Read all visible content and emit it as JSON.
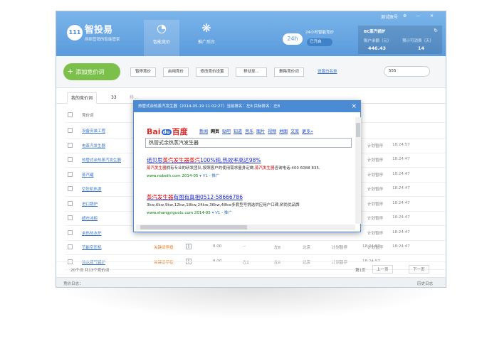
{
  "app": {
    "name": "智投易",
    "subtitle": "网络营销的智能管家"
  },
  "nav": [
    {
      "label": "智能竞价",
      "icon": "gauge-icon"
    },
    {
      "label": "推广后台",
      "icon": "paw-icon"
    }
  ],
  "window_controls": {
    "account": "测试账号",
    "gear": "⚙",
    "minimize": "—",
    "close": "✕"
  },
  "auto_bid": {
    "label": "24小时智能竞价",
    "state": "已开启",
    "badge": "24h"
  },
  "account": {
    "title": "BC蒸汽锅炉",
    "balance_label": "账户余额（元）",
    "balance": "446.43",
    "days_label": "预计可消费（天）",
    "days": "14"
  },
  "toolbar": {
    "add_label": "添加竞价词",
    "buttons": [
      "暂停竞价",
      "启用竞价",
      "修改竞价设置",
      "移动至...",
      "删除竞价词"
    ],
    "whitelist": "设置白名单",
    "search_value": "555"
  },
  "tabs": [
    {
      "label": "我的竞价词"
    },
    {
      "label": "33"
    },
    {
      "label": "移..."
    }
  ],
  "grid": {
    "header": "竞价词",
    "rows": [
      {
        "kw": "设备安装工程",
        "status": "",
        "c3": "",
        "c4": "",
        "c5": "",
        "c6": "",
        "c7": "",
        "c8": "",
        "c9": ""
      },
      {
        "kw": "电蒸汽发生器",
        "status": "",
        "c3": "",
        "c4": "",
        "c5": "",
        "c6": "",
        "c7": "",
        "c8": "",
        "c9": ""
      },
      {
        "kw": "热管式余热蒸汽发生器",
        "status": "",
        "c3": "",
        "c4": "",
        "c5": "",
        "c6": "",
        "c7": "",
        "c8": "",
        "c9": ""
      },
      {
        "kw": "蒸汽罐",
        "status": "",
        "c3": "",
        "c4": "",
        "c5": "",
        "c6": "",
        "c7": "",
        "c8": "",
        "c9": ""
      },
      {
        "kw": "空压机热源",
        "status": "",
        "c3": "",
        "c4": "",
        "c5": "",
        "c6": "",
        "c7": "",
        "c8": "",
        "c9": ""
      },
      {
        "kw": "进口锅炉",
        "status": "",
        "c3": "",
        "c4": "",
        "c5": "",
        "c6": "",
        "c7": "",
        "c8": "",
        "c9": ""
      },
      {
        "kw": "超市冰柜",
        "status": "",
        "c3": "",
        "c4": "",
        "c5": "",
        "c6": "",
        "c7": "",
        "c8": "",
        "c9": ""
      },
      {
        "kw": "余热热水炉",
        "status": "",
        "c3": "",
        "c4": "",
        "c5": "",
        "c6": "",
        "c7": "",
        "c8": "",
        "c9": ""
      },
      {
        "kw": "节能空压机",
        "status": "关键词停投",
        "c3": "8.00",
        "c4": "--",
        "c5": "左8",
        "c6": "北京",
        "c7": "计划暂停",
        "c8": "18:24:57",
        "c9": ""
      },
      {
        "kw": "热水燃气锅炉",
        "status": "关键词停投",
        "c3": "8.00",
        "c4": "左2",
        "c5": "左8",
        "c6": "北京",
        "c7": "计划暂停",
        "c8": "18:24:57",
        "c9": ""
      }
    ],
    "right_rows": [
      {
        "a": "计划暂停",
        "b": "18:24:57"
      },
      {
        "a": "计划暂停",
        "b": "18:24:47"
      },
      {
        "a": "计划暂停",
        "b": "18:24:47"
      },
      {
        "a": "计划暂停",
        "b": "18:24:47"
      },
      {
        "a": "计划暂停",
        "b": "18:24:47"
      },
      {
        "a": "计划暂停",
        "b": "18:24:47"
      },
      {
        "a": "计划暂停",
        "b": "18:24:47"
      },
      {
        "a": "计划暂停",
        "b": "18:24:47"
      }
    ]
  },
  "footer": {
    "count": "20个词 共13个竞价词",
    "first": "第1页",
    "prev": "上一页",
    "next": "下一页"
  },
  "status_bar": {
    "left": "竞价日志：",
    "right": "历史日志"
  },
  "popup": {
    "title": "热管式余热蒸汽发生器（2014-05-19 11:02:27）当前排名：左8 目标排名：左8",
    "baidu_nav": [
      "新闻",
      "网页",
      "贴吧",
      "知道",
      "音乐",
      "图片",
      "视频",
      "地图",
      "文库",
      "更多»"
    ],
    "baidu_nav_active": "网页",
    "query": "热管式余热蒸汽发生器",
    "results": [
      {
        "title_pre": "诺贝思",
        "title_hl": "蒸汽发生器蒸汽",
        "title_post": "100%纯,热效率高达98%",
        "desc_hl1": "蒸汽发生器",
        "desc_mid": "拥有专业的研发团队,按照客户的使用需求量身定做,",
        "desc_hl2": "蒸汽发生器",
        "desc_tail": "咨询电话:400 6088 835.",
        "url": "www.nobeth.com 2014-05",
        "tag": "推广"
      },
      {
        "title_pre": "",
        "title_hl": "蒸汽发生器",
        "title_post": "有图有真相0512-58666786",
        "desc_hl1": "",
        "desc_mid": "3kw,6kw,9kw,12kw,18kw,24kw,36kw,48kw多套型号挑选供应用户口碑,树尚优品牌",
        "desc_hl2": "",
        "desc_tail": "",
        "url": "www.shangyiguolu.com 2014-05",
        "tag": "推广"
      }
    ]
  }
}
